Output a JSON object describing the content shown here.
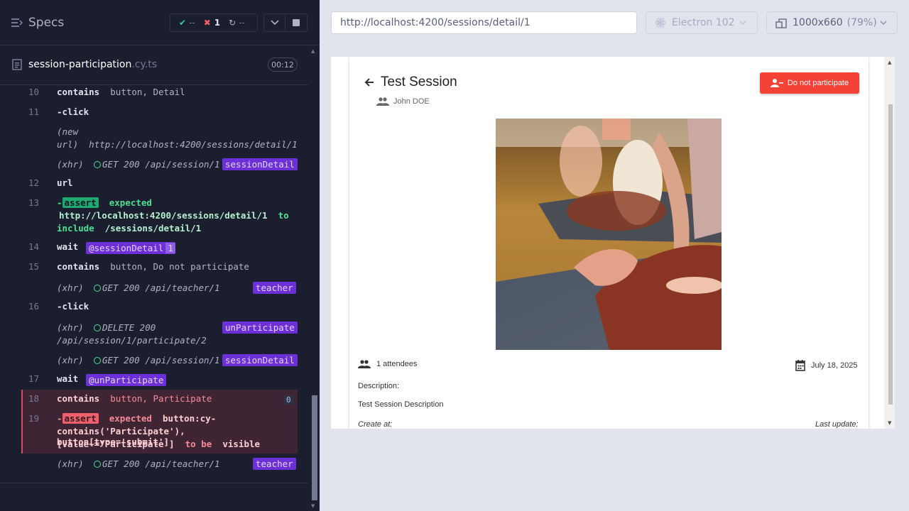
{
  "header": {
    "specs_label": "Specs",
    "passed": "--",
    "failed": "1",
    "pending": "--"
  },
  "file": {
    "name": "session-participation",
    "ext": ".cy.ts",
    "duration": "00:12"
  },
  "log": {
    "l10_num": "10",
    "l10_cmd": "contains",
    "l10_arg": "button, Detail",
    "l11_num": "11",
    "l11_cmd": "-click",
    "newurl_a": "(new",
    "newurl_b": "url)",
    "newurl_val": "http://localhost:4200/sessions/detail/1",
    "xhr1_pre": "(xhr)",
    "xhr1_text": "GET 200 /api/session/1",
    "xhr1_tag": "sessionDetail",
    "l12_num": "12",
    "l12_cmd": "url",
    "l13_num": "13",
    "l13_dash": "-",
    "l13_assert": "assert",
    "l13_expected": "expected",
    "l13_url": "http://localhost:4200/sessions/detail/1",
    "l13_to": "to",
    "l13_include": "include",
    "l13_path": "/sessions/detail/1",
    "l14_num": "14",
    "l14_cmd": "wait",
    "l14_alias": "@sessionDetail",
    "l14_count": "1",
    "l15_num": "15",
    "l15_cmd": "contains",
    "l15_arg": "button, Do not participate",
    "xhr2_pre": "(xhr)",
    "xhr2_text": "GET 200 /api/teacher/1",
    "xhr2_tag": "teacher",
    "l16_num": "16",
    "l16_cmd": "-click",
    "xhr3_pre": "(xhr)",
    "xhr3_text": "DELETE 200",
    "xhr3_text2": "/api/session/1/participate/2",
    "xhr3_tag": "unParticipate",
    "xhr4_pre": "(xhr)",
    "xhr4_text": "GET 200 /api/session/1",
    "xhr4_tag": "sessionDetail",
    "l17_num": "17",
    "l17_cmd": "wait",
    "l17_alias": "@unParticipate",
    "l18_num": "18",
    "l18_cmd": "contains",
    "l18_arg": "button, Participate",
    "l18_count": "0",
    "l19_num": "19",
    "l19_dash": "-",
    "l19_assert": "assert",
    "l19_expected": "expected",
    "l19_sel1": "button:cy-",
    "l19_sel2": "contains('Participate'), button[type='submit']",
    "l19_sel3": "[value~='Participate']",
    "l19_tobe": "to be",
    "l19_visible": "visible",
    "xhr5_pre": "(xhr)",
    "xhr5_text": "GET 200 /api/teacher/1",
    "xhr5_tag": "teacher"
  },
  "toolbar": {
    "url": "http://localhost:4200/sessions/detail/1",
    "browser": "Electron 102",
    "viewport": "1000x660",
    "zoom": "(79%)"
  },
  "app": {
    "title": "Test Session",
    "teacher": "John DOE",
    "button": "Do not participate",
    "attendees": "1 attendees",
    "date": "July 18, 2025",
    "desc_label": "Description:",
    "desc_text": "Test Session Description",
    "created": "Create at:",
    "updated": "Last update:"
  },
  "colors": {
    "panel_bg": "#1b1e2e",
    "alias_purple": "#6d2fd8",
    "pass_green": "#1fa971",
    "fail_red": "#f05f6c",
    "warn_button": "#f44336"
  }
}
